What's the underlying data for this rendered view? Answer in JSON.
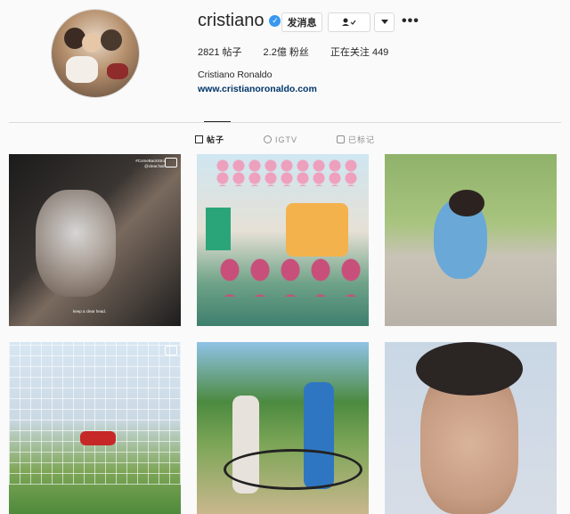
{
  "profile": {
    "username": "cristiano",
    "verified_icon": "verified-badge-icon",
    "buttons": {
      "message": "发消息",
      "follow_icon": "person-check-icon",
      "dropdown_icon": "chevron-down-icon",
      "more_icon": "ellipsis-icon"
    },
    "stats": {
      "posts": "2821 帖子",
      "followers": "2.2億 粉丝",
      "following": "正在关注 449"
    },
    "full_name": "Cristiano Ronaldo",
    "website": "www.cristianoronaldo.com"
  },
  "tabs": [
    {
      "label": "帖子",
      "icon": "grid-icon",
      "active": true
    },
    {
      "label": "IGTV",
      "icon": "igtv-icon",
      "active": false
    },
    {
      "label": "已标记",
      "icon": "tagged-icon",
      "active": false
    }
  ],
  "posts": [
    {
      "caption_top_1": "#ComeBackStro",
      "caption_top_2": "@clear.hair",
      "caption_bottom": "keep a clear head.",
      "tv_icon": "igtv-icon"
    },
    {
      "tv_icon": ""
    },
    {
      "tv_icon": ""
    },
    {
      "tv_icon": "igtv-icon"
    },
    {
      "tv_icon": ""
    },
    {
      "tv_icon": ""
    }
  ],
  "colors": {
    "link": "#003569",
    "verified": "#3897f0",
    "border": "#dbdbdb",
    "bg": "#fafafa"
  }
}
